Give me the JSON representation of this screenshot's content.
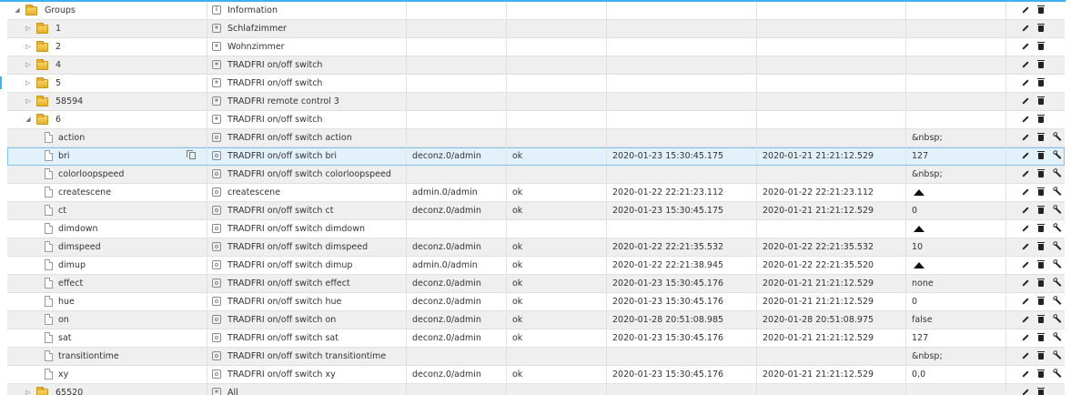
{
  "icons": {
    "expanded": "triangle-down-icon",
    "collapsed": "triangle-right-icon",
    "folder": "folder-icon",
    "state": "document-icon",
    "edit": "pencil-icon",
    "delete": "trash-icon",
    "settings": "wrench-icon",
    "copy": "copy-icon"
  },
  "rows": [
    {
      "type": "folder",
      "toggle": "◢",
      "name": "Groups",
      "title_icon": "info",
      "title": "Information",
      "from": "",
      "q": "",
      "ts": "",
      "lc": "",
      "value": "",
      "actions": [
        "edit",
        "delete"
      ]
    },
    {
      "type": "folder",
      "toggle": "▷",
      "name": "1",
      "title_icon": "device",
      "title": "Schlafzimmer",
      "from": "",
      "q": "",
      "ts": "",
      "lc": "",
      "value": "",
      "actions": [
        "edit",
        "delete"
      ]
    },
    {
      "type": "folder",
      "toggle": "▷",
      "name": "2",
      "title_icon": "device",
      "title": "Wohnzimmer",
      "from": "",
      "q": "",
      "ts": "",
      "lc": "",
      "value": "",
      "actions": [
        "edit",
        "delete"
      ]
    },
    {
      "type": "folder",
      "toggle": "▷",
      "name": "4",
      "title_icon": "device",
      "title": "TRADFRI on/off switch",
      "from": "",
      "q": "",
      "ts": "",
      "lc": "",
      "value": "",
      "actions": [
        "edit",
        "delete"
      ]
    },
    {
      "type": "folder",
      "toggle": "▷",
      "name": "5",
      "title_icon": "device",
      "title": "TRADFRI on/off switch",
      "from": "",
      "q": "",
      "ts": "",
      "lc": "",
      "value": "",
      "actions": [
        "edit",
        "delete"
      ]
    },
    {
      "type": "folder",
      "toggle": "▷",
      "name": "58594",
      "title_icon": "device",
      "title": "TRADFRI remote control 3",
      "from": "",
      "q": "",
      "ts": "",
      "lc": "",
      "value": "",
      "actions": [
        "edit",
        "delete"
      ]
    },
    {
      "type": "folder",
      "toggle": "◢",
      "name": "6",
      "title_icon": "device",
      "title": "TRADFRI on/off switch",
      "from": "",
      "q": "",
      "ts": "",
      "lc": "",
      "value": "",
      "actions": [
        "edit",
        "delete"
      ]
    },
    {
      "type": "state",
      "name": "action",
      "title_icon": "state",
      "title": "TRADFRI on/off switch action",
      "from": "",
      "q": "",
      "ts": "",
      "lc": "",
      "value": "&nbsp;",
      "actions": [
        "edit",
        "delete",
        "settings"
      ]
    },
    {
      "type": "state",
      "name": "bri",
      "selected": true,
      "title_icon": "state",
      "title": "TRADFRI on/off switch bri",
      "from": "deconz.0/admin",
      "q": "ok",
      "ts": "2020-01-23 15:30:45.175",
      "lc": "2020-01-21 21:21:12.529",
      "value": "127",
      "actions": [
        "edit",
        "delete",
        "settings"
      ]
    },
    {
      "type": "state",
      "name": "colorloopspeed",
      "title_icon": "state",
      "title": "TRADFRI on/off switch colorloopspeed",
      "from": "",
      "q": "",
      "ts": "",
      "lc": "",
      "value": "&nbsp;",
      "actions": [
        "edit",
        "delete",
        "settings"
      ]
    },
    {
      "type": "state",
      "name": "createscene",
      "title_icon": "state",
      "title": "createscene",
      "from": "admin.0/admin",
      "q": "ok",
      "ts": "2020-01-22 22:21:23.112",
      "lc": "2020-01-22 22:21:23.112",
      "value": "",
      "value_icon": true,
      "actions": [
        "edit",
        "delete",
        "settings"
      ]
    },
    {
      "type": "state",
      "name": "ct",
      "title_icon": "state",
      "title": "TRADFRI on/off switch ct",
      "from": "deconz.0/admin",
      "q": "ok",
      "ts": "2020-01-23 15:30:45.175",
      "lc": "2020-01-21 21:21:12.529",
      "value": "0",
      "actions": [
        "edit",
        "delete",
        "settings"
      ]
    },
    {
      "type": "state",
      "name": "dimdown",
      "title_icon": "state",
      "title": "TRADFRI on/off switch dimdown",
      "from": "",
      "q": "",
      "ts": "",
      "lc": "",
      "value": "",
      "value_icon": true,
      "actions": [
        "edit",
        "delete",
        "settings"
      ]
    },
    {
      "type": "state",
      "name": "dimspeed",
      "title_icon": "state",
      "title": "TRADFRI on/off switch dimspeed",
      "from": "deconz.0/admin",
      "q": "ok",
      "ts": "2020-01-22 22:21:35.532",
      "lc": "2020-01-22 22:21:35.532",
      "value": "10",
      "actions": [
        "edit",
        "delete",
        "settings"
      ]
    },
    {
      "type": "state",
      "name": "dimup",
      "title_icon": "state",
      "title": "TRADFRI on/off switch dimup",
      "from": "admin.0/admin",
      "q": "ok",
      "ts": "2020-01-22 22:21:38.945",
      "lc": "2020-01-22 22:21:35.520",
      "value": "",
      "value_icon": true,
      "actions": [
        "edit",
        "delete",
        "settings"
      ]
    },
    {
      "type": "state",
      "name": "effect",
      "title_icon": "state",
      "title": "TRADFRI on/off switch effect",
      "from": "deconz.0/admin",
      "q": "ok",
      "ts": "2020-01-23 15:30:45.176",
      "lc": "2020-01-21 21:21:12.529",
      "value": "none",
      "actions": [
        "edit",
        "delete",
        "settings"
      ]
    },
    {
      "type": "state",
      "name": "hue",
      "title_icon": "state",
      "title": "TRADFRI on/off switch hue",
      "from": "deconz.0/admin",
      "q": "ok",
      "ts": "2020-01-23 15:30:45.176",
      "lc": "2020-01-21 21:21:12.529",
      "value": "0",
      "actions": [
        "edit",
        "delete",
        "settings"
      ]
    },
    {
      "type": "state",
      "name": "on",
      "title_icon": "state",
      "title": "TRADFRI on/off switch on",
      "from": "deconz.0/admin",
      "q": "ok",
      "ts": "2020-01-28 20:51:08.985",
      "lc": "2020-01-28 20:51:08.975",
      "value": "false",
      "actions": [
        "edit",
        "delete",
        "settings"
      ]
    },
    {
      "type": "state",
      "name": "sat",
      "title_icon": "state",
      "title": "TRADFRI on/off switch sat",
      "from": "deconz.0/admin",
      "q": "ok",
      "ts": "2020-01-23 15:30:45.176",
      "lc": "2020-01-21 21:21:12.529",
      "value": "127",
      "actions": [
        "edit",
        "delete",
        "settings"
      ]
    },
    {
      "type": "state",
      "name": "transitiontime",
      "title_icon": "state",
      "title": "TRADFRI on/off switch transitiontime",
      "from": "",
      "q": "",
      "ts": "",
      "lc": "",
      "value": "&nbsp;",
      "actions": [
        "edit",
        "delete",
        "settings"
      ]
    },
    {
      "type": "state",
      "name": "xy",
      "title_icon": "state",
      "title": "TRADFRI on/off switch xy",
      "from": "deconz.0/admin",
      "q": "ok",
      "ts": "2020-01-23 15:30:45.176",
      "lc": "2020-01-21 21:21:12.529",
      "value": "0,0",
      "actions": [
        "edit",
        "delete",
        "settings"
      ]
    },
    {
      "type": "folder",
      "toggle": "▷",
      "name": "65520",
      "title_icon": "device",
      "title": "All",
      "from": "",
      "q": "",
      "ts": "",
      "lc": "",
      "value": "",
      "actions": [
        "edit",
        "delete"
      ],
      "cut": true
    }
  ]
}
